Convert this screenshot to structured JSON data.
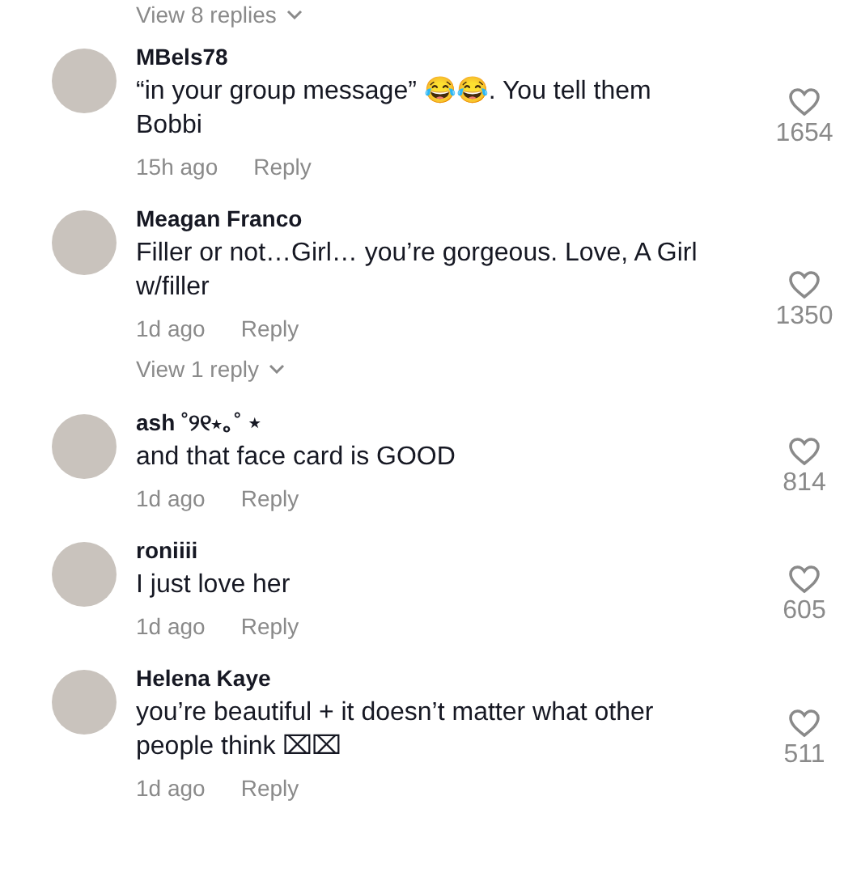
{
  "top_replies_link": {
    "label": "View 8 replies"
  },
  "comments": [
    {
      "author": "MBels78",
      "text": "“in your group message” 😂😂. You tell them Bobbi",
      "time": "15h ago",
      "reply": "Reply",
      "likes": "1654",
      "liked": false
    },
    {
      "author": "Meagan Franco",
      "text": "Filler or not…Girl… you’re gorgeous. Love, A Girl w/filler",
      "time": "1d ago",
      "reply": "Reply",
      "likes": "1350",
      "liked": false,
      "view_replies": "View 1 reply"
    },
    {
      "author": "ash ˚୨୧⋆｡˚ ⋆",
      "text": "and that face card is GOOD",
      "time": "1d ago",
      "reply": "Reply",
      "likes": "814",
      "liked": false
    },
    {
      "author": "roniiii",
      "text": "I just love her",
      "time": "1d ago",
      "reply": "Reply",
      "likes": "605",
      "liked": false
    },
    {
      "author": "Helena Kaye",
      "text": "you’re beautiful + it doesn’t matter what other people think ⌧⌧",
      "time": "1d ago",
      "reply": "Reply",
      "likes": "511",
      "liked": false
    }
  ]
}
